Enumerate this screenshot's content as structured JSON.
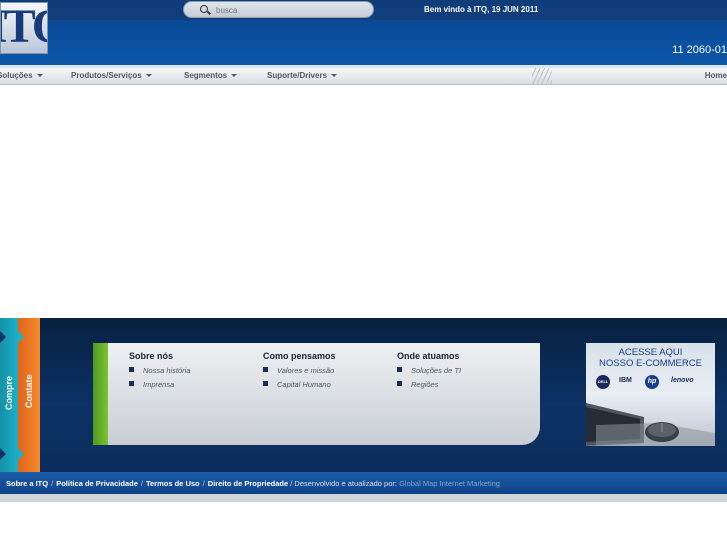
{
  "header": {
    "logo_text": "ITQ",
    "search_placeholder": "busca",
    "welcome": "Bem vindo à ITQ, 19 JUN 2011",
    "phone": "11 2060-01"
  },
  "nav": {
    "items": [
      {
        "label": "Soluções"
      },
      {
        "label": "Produtos/Serviços"
      },
      {
        "label": "Segmentos"
      },
      {
        "label": "Suporte/Drivers"
      }
    ],
    "home": "Home"
  },
  "side_tabs": {
    "compre": "Compre",
    "contate": "Contate"
  },
  "footer_menu": {
    "columns": [
      {
        "title": "Sobre nós",
        "links": [
          "Nossa história",
          "Imprensa"
        ]
      },
      {
        "title": "Como pensamos",
        "links": [
          "Valores e missão",
          "Capital Humano"
        ]
      },
      {
        "title": "Onde atuamos",
        "links": [
          "Soluções de TI",
          "Regiões"
        ]
      }
    ]
  },
  "ecommerce": {
    "line1": "ACESSE AQUI",
    "line2": "NOSSO E-COMMERCE",
    "brands": [
      "DELL",
      "IBM",
      "hp",
      "lenovo"
    ]
  },
  "bottom_links": {
    "items": [
      "Sobre a ITQ",
      "Política de Privacidade",
      "Termos de Uso",
      "Direito de Propriedade"
    ],
    "credit_prefix": "/ Desenvolvido e atualizado por:",
    "credit_name": "Global Map Internet Marketing"
  },
  "colors": {
    "header_blue": "#0d57a9",
    "footer_navy": "#0c3266",
    "tab_teal": "#1cb0c5",
    "tab_orange": "#f58a2d",
    "accent_green": "#7dc234"
  }
}
